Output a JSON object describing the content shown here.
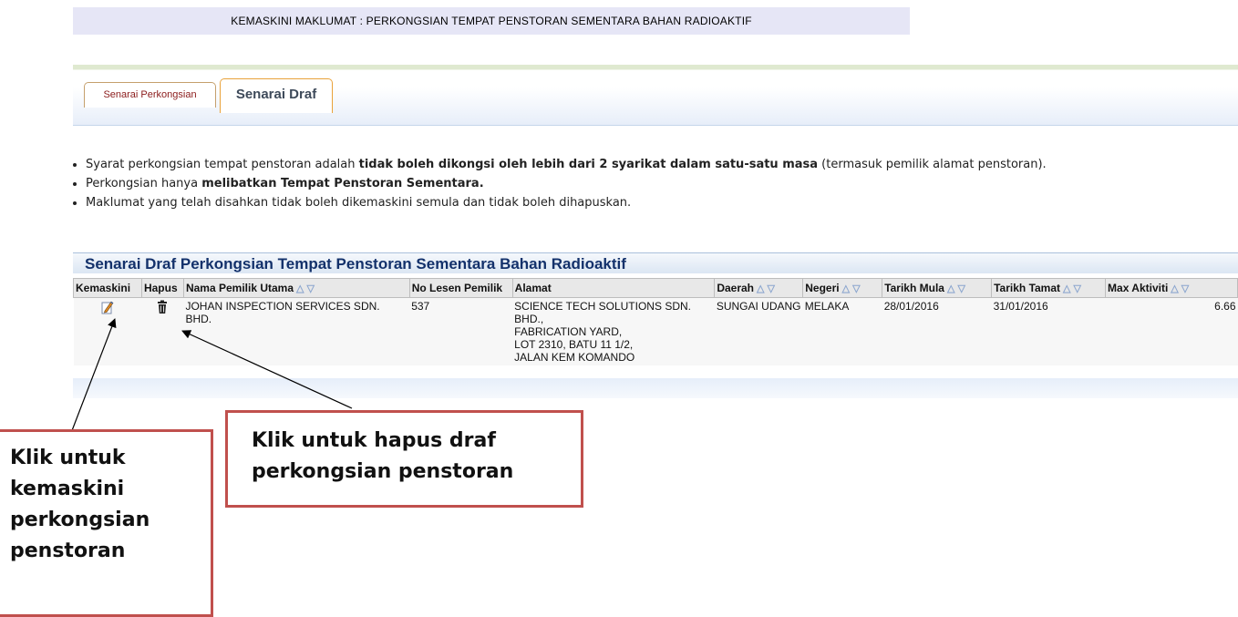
{
  "header": {
    "title": "KEMASKINI MAKLUMAT : PERKONGSIAN TEMPAT PENSTORAN SEMENTARA BAHAN RADIOAKTIF"
  },
  "tabs": [
    {
      "label": "Senarai Perkongsian",
      "active": false
    },
    {
      "label": "Senarai Draf",
      "active": true
    }
  ],
  "notes": [
    {
      "before": "Syarat perkongsian tempat penstoran adalah ",
      "bold": "tidak boleh dikongsi oleh lebih dari 2 syarikat dalam satu-satu masa",
      "after": " (termasuk pemilik alamat penstoran)."
    },
    {
      "before": "Perkongsian hanya ",
      "bold": "melibatkan Tempat Penstoran Sementara.",
      "after": ""
    },
    {
      "before": "Maklumat yang telah disahkan tidak boleh dikemaskini semula dan tidak boleh dihapuskan.",
      "bold": "",
      "after": ""
    }
  ],
  "table": {
    "title": "Senarai Draf Perkongsian Tempat Penstoran Sementara Bahan Radioaktif",
    "sort_up": "△",
    "sort_down": "▽",
    "columns": {
      "kemaskini": "Kemaskini",
      "hapus": "Hapus",
      "nama": "Nama Pemilik Utama",
      "lesen": "No Lesen Pemilik",
      "alamat": "Alamat",
      "daerah": "Daerah",
      "negeri": "Negeri",
      "mula": "Tarikh Mula",
      "tamat": "Tarikh Tamat",
      "max": "Max Aktiviti"
    },
    "row": {
      "edit_icon": "edit-pencil-icon",
      "delete_icon": "trash-icon",
      "nama": "JOHAN INSPECTION SERVICES SDN. BHD.",
      "lesen": "537",
      "alamat_1": "SCIENCE TECH SOLUTIONS SDN. BHD.,",
      "alamat_2": "FABRICATION YARD,",
      "alamat_3": "LOT 2310, BATU 11 1/2,",
      "alamat_4": "JALAN KEM KOMANDO",
      "daerah": "SUNGAI UDANG",
      "negeri": "MELAKA",
      "mula": "28/01/2016",
      "tamat": "31/01/2016",
      "max": "6.66"
    }
  },
  "callouts": {
    "edit_1": "Klik untuk",
    "edit_2": "kemaskini",
    "edit_3": "perkongsian",
    "edit_4": "penstoran",
    "delete_1": "Klik untuk hapus draf",
    "delete_2": "perkongsian penstoran"
  },
  "colors": {
    "tab_text": "#8b1b1b",
    "title_text": "#13316b",
    "callout_border": "#c0504d",
    "sort_arrow": "#8da7cf"
  }
}
